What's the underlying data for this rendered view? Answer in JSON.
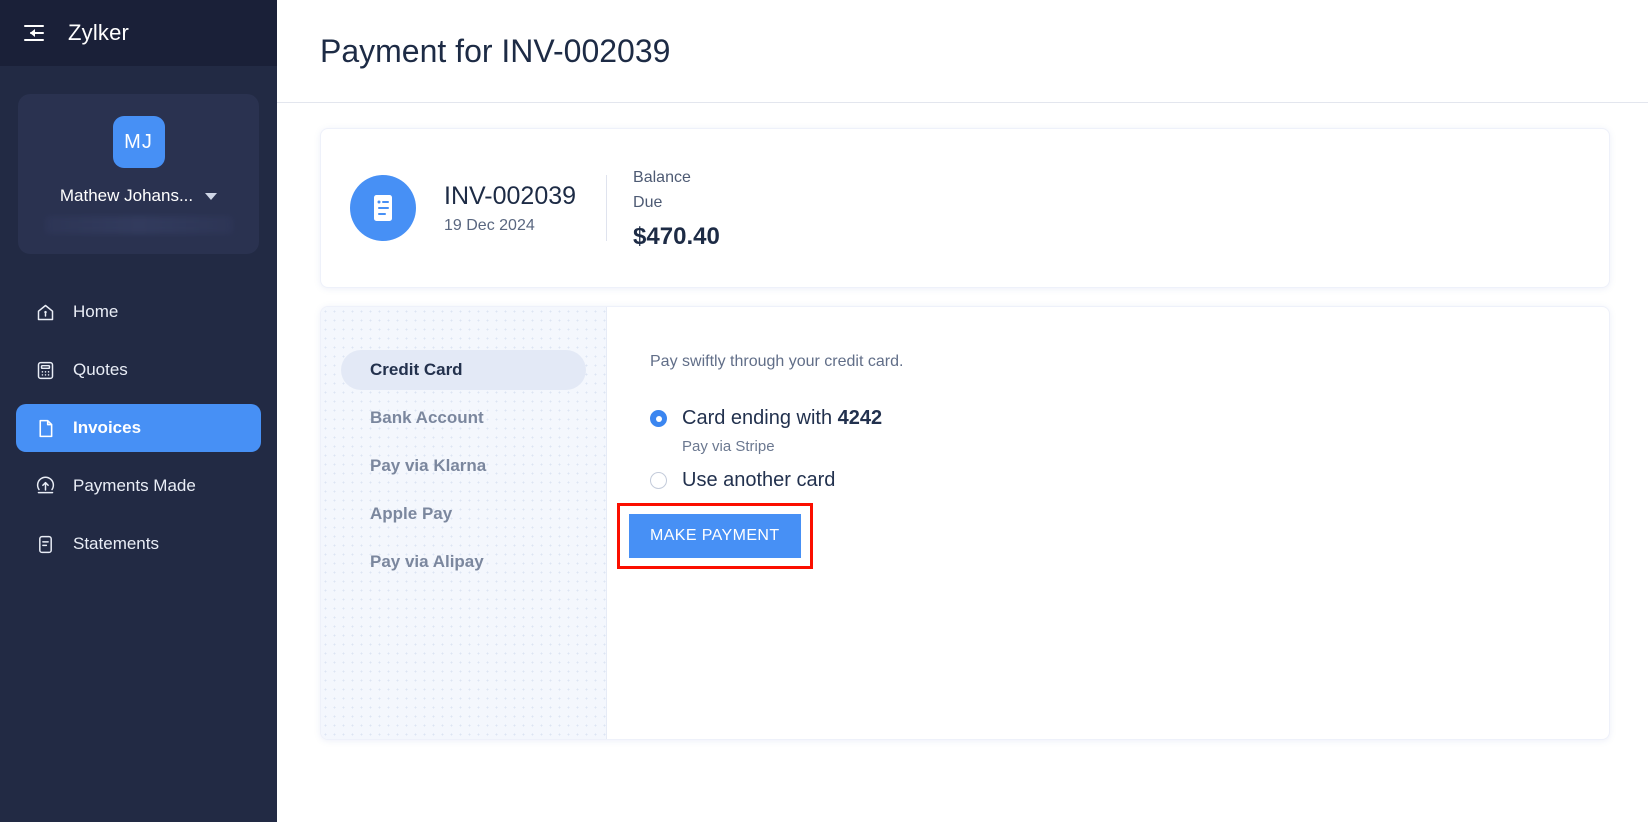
{
  "sidebar": {
    "collapse_icon": "collapse-menu-icon",
    "brand": "Zylker",
    "profile": {
      "initials": "MJ",
      "name": "Mathew Johans...",
      "caret_icon": "chevron-down-icon"
    },
    "nav_items": [
      {
        "label": "Home",
        "icon": "home-icon",
        "active": false
      },
      {
        "label": "Quotes",
        "icon": "calculator-icon",
        "active": false
      },
      {
        "label": "Invoices",
        "icon": "document-icon",
        "active": true
      },
      {
        "label": "Payments Made",
        "icon": "upload-circle-icon",
        "active": false
      },
      {
        "label": "Statements",
        "icon": "statement-icon",
        "active": false
      }
    ]
  },
  "header": {
    "title": "Payment for INV-002039"
  },
  "invoice": {
    "icon": "invoice-document-icon",
    "number": "INV-002039",
    "date": "19 Dec 2024",
    "balance_label": "Balance Due",
    "balance_amount": "$470.40"
  },
  "payment": {
    "methods": [
      {
        "label": "Credit Card",
        "selected": true
      },
      {
        "label": "Bank Account",
        "selected": false
      },
      {
        "label": "Pay via Klarna",
        "selected": false
      },
      {
        "label": "Apple Pay",
        "selected": false
      },
      {
        "label": "Pay via Alipay",
        "selected": false
      }
    ],
    "intro": "Pay swiftly through your credit card.",
    "options": [
      {
        "label_prefix": "Card ending with ",
        "label_strong": "4242",
        "sub": "Pay via Stripe",
        "checked": true
      },
      {
        "label_prefix": "Use another card",
        "label_strong": "",
        "sub": "",
        "checked": false
      }
    ],
    "make_payment_label": "MAKE PAYMENT"
  },
  "colors": {
    "sidebar_bg": "#222a44",
    "sidebar_header_bg": "#1a2038",
    "accent": "#4790f5",
    "highlight_box": "#fb0f00",
    "text_dark": "#1d2b45"
  }
}
